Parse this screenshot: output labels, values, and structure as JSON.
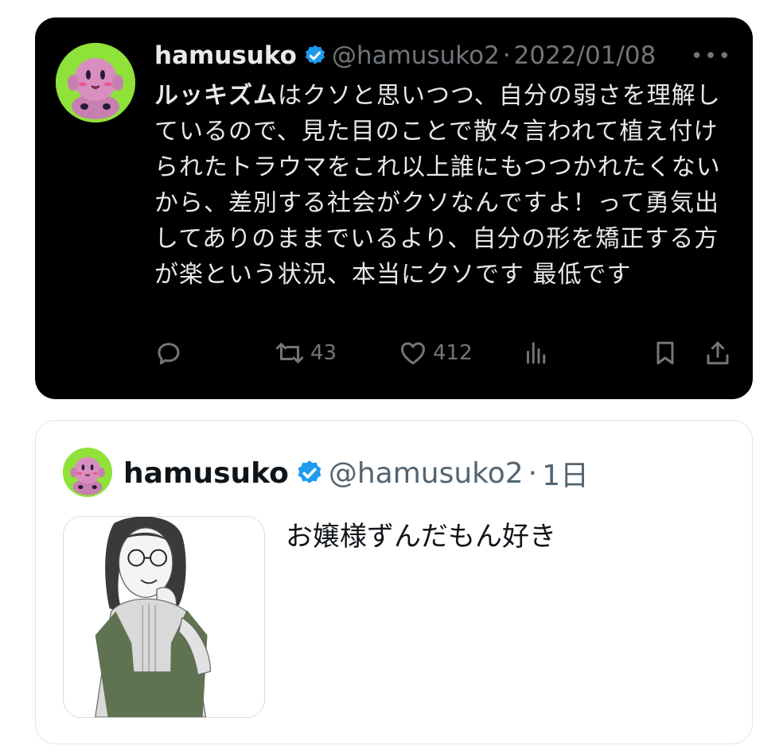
{
  "main_tweet": {
    "display_name": "hamusuko",
    "handle": "@hamusuko2",
    "separator": "·",
    "date": "2022/01/08",
    "more_label": "•••",
    "text_bold": "ルッキズム",
    "text_rest": "はクソと思いつつ、自分の弱さを理解しているので、見た目のことで散々言われて植え付けられたトラウマをこれ以上誰にもつつかれたくないから、差別する社会がクソなんですよ！って勇気出してありのままでいるより、自分の形を矯正する方が楽という状況、本当にクソです 最低です",
    "retweet_count": "43",
    "like_count": "412"
  },
  "quoted_tweet": {
    "display_name": "hamusuko",
    "handle": "@hamusuko2",
    "separator": "·",
    "time": "1日",
    "text": "お嬢様ずんだもん好き"
  },
  "icons": {
    "verified": "verified-badge-icon",
    "reply": "reply-icon",
    "retweet": "retweet-icon",
    "like": "heart-icon",
    "views": "views-icon",
    "bookmark": "bookmark-icon",
    "share": "share-icon"
  },
  "colors": {
    "verified_blue": "#1d9bf0",
    "avatar_green": "#8fe23a",
    "kirby_pink": "#d98ec0",
    "dark_bg": "#000000",
    "muted_text": "#71767b"
  }
}
